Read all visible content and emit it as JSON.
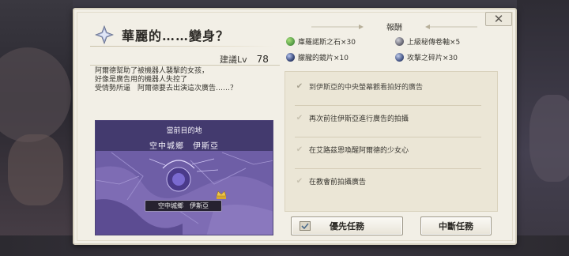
{
  "dialog": {
    "title": "華麗的……變身？",
    "close_label": "✕",
    "recommended_level_label": "建議Lv",
    "recommended_level_value": "78",
    "description_lines": [
      "阿爾德幫助了被機器人襲擊的女孩，",
      "好像是廣告用的機器人失控了",
      "受情勢所逼　阿爾德要去出演這次廣告……？"
    ]
  },
  "map": {
    "current_destination_label": "當前目的地",
    "destination_name": "空中城鄉　伊斯亞",
    "marker_label": "空中城鄉　伊斯亞"
  },
  "rewards": {
    "title": "報酬",
    "items": [
      {
        "label": "庫羅諾斯之石×30",
        "icon": "chronos-stone-icon",
        "color": "#5aa04a"
      },
      {
        "label": "上級秘傳卷軸×5",
        "icon": "scroll-icon",
        "color": "#6e6e7a"
      },
      {
        "label": "朦朧的鏡片×10",
        "icon": "lens-icon",
        "color": "#3a4a7a"
      },
      {
        "label": "攻擊之碎片×30",
        "icon": "attack-fragment-icon",
        "color": "#4a5a8a"
      }
    ]
  },
  "quests": [
    {
      "label": "到伊斯亞的中央螢幕觀看拍好的廣告",
      "state": "current"
    },
    {
      "label": "再次前往伊斯亞進行廣告的拍攝",
      "state": "done"
    },
    {
      "label": "在艾路茲恩喚醒阿爾德的少女心",
      "state": "done"
    },
    {
      "label": "在教會前拍攝廣告",
      "state": "done"
    }
  ],
  "buttons": {
    "priority_label": "優先任務",
    "abort_label": "中斷任務"
  },
  "colors": {
    "dialog_bg": "#f2efe6",
    "panel_bg": "#ebe6d6",
    "map_bg": "#6b5ba0"
  }
}
